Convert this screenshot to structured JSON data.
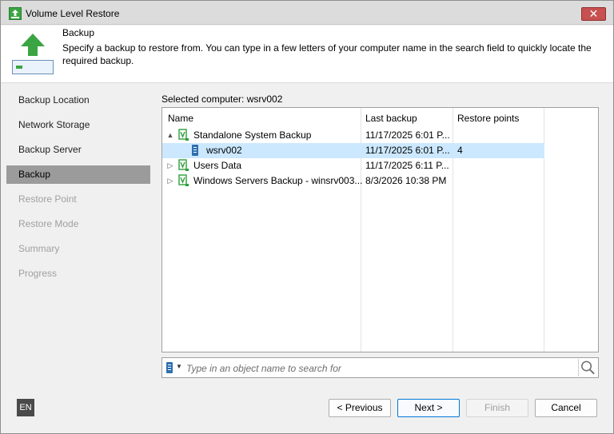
{
  "window": {
    "title": "Volume Level Restore",
    "close_label": "✕"
  },
  "header": {
    "title": "Backup",
    "description": "Specify a backup to restore from. You can type in a few letters of your computer name in the search field to quickly locate the required backup."
  },
  "sidebar": {
    "items": [
      {
        "label": "Backup Location",
        "state": "enabled"
      },
      {
        "label": "Network Storage",
        "state": "enabled"
      },
      {
        "label": "Backup Server",
        "state": "enabled"
      },
      {
        "label": "Backup",
        "state": "active"
      },
      {
        "label": "Restore Point",
        "state": "disabled"
      },
      {
        "label": "Restore Mode",
        "state": "disabled"
      },
      {
        "label": "Summary",
        "state": "disabled"
      },
      {
        "label": "Progress",
        "state": "disabled"
      }
    ]
  },
  "main": {
    "selected_computer": "Selected computer: wsrv002",
    "columns": [
      "Name",
      "Last backup",
      "Restore points"
    ],
    "rows": [
      {
        "name": "Standalone System Backup",
        "last_backup": "11/17/2025 6:01 P...",
        "restore_points": "",
        "expanded": "▲",
        "type": "backup"
      },
      {
        "name": "wsrv002",
        "last_backup": "11/17/2025 6:01 P...",
        "restore_points": "4",
        "expanded": "",
        "type": "computer"
      },
      {
        "name": "Users Data",
        "last_backup": "11/17/2025 6:11 P...",
        "restore_points": "",
        "expanded": "▷",
        "type": "backup"
      },
      {
        "name": "Windows Servers Backup - winsrv003...",
        "last_backup": "8/3/2026 10:38 PM",
        "restore_points": "",
        "expanded": "▷",
        "type": "backup"
      }
    ],
    "search_placeholder": "Type in an object name to search for"
  },
  "footer": {
    "language": "EN",
    "previous_label": "< Previous",
    "next_label": "Next >",
    "finish_label": "Finish",
    "cancel_label": "Cancel"
  },
  "colors": {
    "accent_green": "#2e9e3a",
    "selection": "#cce8ff",
    "active_nav": "#9b9b9b"
  }
}
